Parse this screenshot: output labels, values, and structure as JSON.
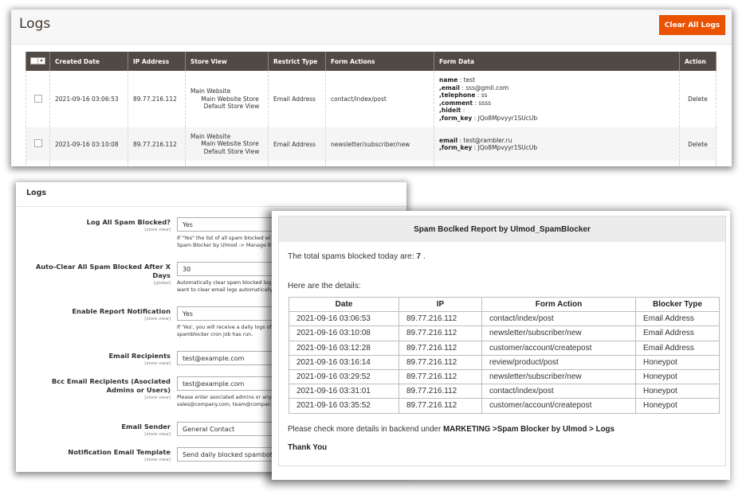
{
  "logs_grid": {
    "title": "Logs",
    "clear_button": "Clear All Logs",
    "columns": [
      "Created Date",
      "IP Address",
      "Store View",
      "Restrict Type",
      "Form Actions",
      "Form Data",
      "Action"
    ],
    "rows": [
      {
        "created_date": "2021-09-16 03:06:53",
        "ip": "89.77.216.112",
        "store_view": [
          "Main Website",
          "Main Website Store",
          "Default Store View"
        ],
        "restrict_type": "Email Address",
        "form_action": "contact/index/post",
        "form_data": [
          {
            "prefix": "",
            "key": "name",
            "value": " : test"
          },
          {
            "prefix": ",",
            "key": "email",
            "value": " : sss@gmil.com"
          },
          {
            "prefix": ",",
            "key": "telephone",
            "value": " : ss"
          },
          {
            "prefix": ",",
            "key": "comment",
            "value": " : ssss"
          },
          {
            "prefix": ",",
            "key": "hideit",
            "value": " :"
          },
          {
            "prefix": ",",
            "key": "form_key",
            "value": " : JQo8Mpvyyr1SUcUb"
          }
        ],
        "action": "Delete"
      },
      {
        "created_date": "2021-09-16 03:10:08",
        "ip": "89.77.216.112",
        "store_view": [
          "Main Website",
          "Main Website Store",
          "Default Store View"
        ],
        "restrict_type": "Email Address",
        "form_action": "newsletter/subscriber/new",
        "form_data": [
          {
            "prefix": "",
            "key": "email",
            "value": " : test@rambler.ru"
          },
          {
            "prefix": ",",
            "key": "form_key",
            "value": " : JQo8Mpvyyr1SUcUb"
          }
        ],
        "action": "Delete"
      }
    ]
  },
  "config": {
    "title": "Logs",
    "fields": [
      {
        "label": "Log All Spam Blocked?",
        "scope": "[store view]",
        "value": "Yes",
        "note": [
          "If \"Yes\" the list of all spam blocked wi",
          "Spam Blocker by Ulmod -> Manage B"
        ]
      },
      {
        "label": "Auto-Clear All Spam Blocked After X Days",
        "scope": "[global]",
        "value": "30",
        "note": [
          "Automatically clear spam blocked log",
          "want to clear email logs automatically"
        ]
      },
      {
        "label": "Enable Report Notification",
        "scope": "[store view]",
        "value": "Yes",
        "note": [
          "If 'Yes', you will receive a daily logs of",
          "spamblocker cron job has run."
        ]
      },
      {
        "label": "Email Recipients",
        "scope": "[store view]",
        "value": "test@example.com",
        "note": []
      },
      {
        "label": "Bcc Email Recipients (Asociated Admins or Users)",
        "scope": "[store view]",
        "value": "test@example.com",
        "note": [
          "Please enter asociated admins or any",
          "sales@company.com, team@compan"
        ]
      },
      {
        "label": "Email Sender",
        "scope": "[store view]",
        "value": "General Contact",
        "note": []
      },
      {
        "label": "Notification Email Template",
        "scope": "[store view]",
        "value": "Send daily blocked spambots l",
        "note": []
      }
    ]
  },
  "report": {
    "header": "Spam Boclked Report by Ulmod_SpamBlocker",
    "total_prefix": "The total spams blocked today are: ",
    "total_count": "7",
    "total_suffix": " .",
    "details_label": "Here are the details:",
    "columns": [
      "Date",
      "IP",
      "Form Action",
      "Blocker Type"
    ],
    "rows": [
      [
        "2021-09-16 03:06:53",
        "89.77.216.112",
        "contact/index/post",
        "Email Address"
      ],
      [
        "2021-09-16 03:10:08",
        "89.77.216.112",
        "newsletter/subscriber/new",
        "Email Address"
      ],
      [
        "2021-09-16 03:12:28",
        "89.77.216.112",
        "customer/account/createpost",
        "Email Address"
      ],
      [
        "2021-09-16 03:16:14",
        "89.77.216.112",
        "review/product/post",
        "Honeypot"
      ],
      [
        "2021-09-16 03:29:52",
        "89.77.216.112",
        "newsletter/subscriber/new",
        "Honeypot"
      ],
      [
        "2021-09-16 03:31:01",
        "89.77.216.112",
        "contact/index/post",
        "Honeypot"
      ],
      [
        "2021-09-16 03:35:52",
        "89.77.216.112",
        "customer/account/createpost",
        "Honeypot"
      ]
    ],
    "check_prefix": "Please check more details in backend under ",
    "check_path": "MARKETING >Spam Blocker by Ulmod > Logs",
    "thanks": "Thank You"
  }
}
